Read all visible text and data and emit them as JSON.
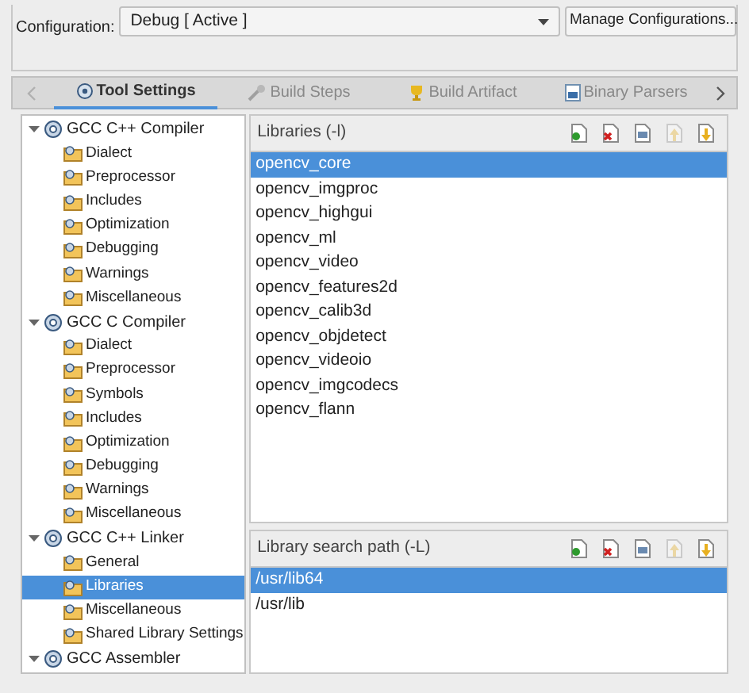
{
  "configuration": {
    "label": "Configuration:",
    "value": "Debug  [ Active ]",
    "manage_button": "Manage Configurations..."
  },
  "tabs": [
    {
      "label": "Tool Settings",
      "selected": true,
      "kind": "tool"
    },
    {
      "label": "Build Steps",
      "selected": false,
      "kind": "wrench"
    },
    {
      "label": "Build Artifact",
      "selected": false,
      "kind": "trophy"
    },
    {
      "label": "Binary Parsers",
      "selected": false,
      "kind": "binary"
    }
  ],
  "tree": [
    {
      "label": "GCC C++ Compiler",
      "expanded": true,
      "children": [
        {
          "label": "Dialect",
          "selected": false
        },
        {
          "label": "Preprocessor",
          "selected": false
        },
        {
          "label": "Includes",
          "selected": false
        },
        {
          "label": "Optimization",
          "selected": false
        },
        {
          "label": "Debugging",
          "selected": false
        },
        {
          "label": "Warnings",
          "selected": false
        },
        {
          "label": "Miscellaneous",
          "selected": false
        }
      ]
    },
    {
      "label": "GCC C Compiler",
      "expanded": true,
      "children": [
        {
          "label": "Dialect",
          "selected": false
        },
        {
          "label": "Preprocessor",
          "selected": false
        },
        {
          "label": "Symbols",
          "selected": false
        },
        {
          "label": "Includes",
          "selected": false
        },
        {
          "label": "Optimization",
          "selected": false
        },
        {
          "label": "Debugging",
          "selected": false
        },
        {
          "label": "Warnings",
          "selected": false
        },
        {
          "label": "Miscellaneous",
          "selected": false
        }
      ]
    },
    {
      "label": "GCC C++ Linker",
      "expanded": true,
      "children": [
        {
          "label": "General",
          "selected": false
        },
        {
          "label": "Libraries",
          "selected": true
        },
        {
          "label": "Miscellaneous",
          "selected": false
        },
        {
          "label": "Shared Library Settings",
          "selected": false
        }
      ]
    },
    {
      "label": "GCC Assembler",
      "expanded": true
    }
  ],
  "lists": [
    {
      "title": "Libraries (-l)",
      "tools": [
        {
          "kind": "add",
          "disabled": false
        },
        {
          "kind": "delete",
          "disabled": false
        },
        {
          "kind": "edit",
          "disabled": false
        },
        {
          "kind": "up",
          "disabled": true
        },
        {
          "kind": "down",
          "disabled": false
        }
      ],
      "items": [
        {
          "label": "opencv_core",
          "selected": true
        },
        {
          "label": "opencv_imgproc",
          "selected": false
        },
        {
          "label": "opencv_highgui",
          "selected": false
        },
        {
          "label": "opencv_ml",
          "selected": false
        },
        {
          "label": "opencv_video",
          "selected": false
        },
        {
          "label": "opencv_features2d",
          "selected": false
        },
        {
          "label": "opencv_calib3d",
          "selected": false
        },
        {
          "label": "opencv_objdetect",
          "selected": false
        },
        {
          "label": "opencv_videoio",
          "selected": false
        },
        {
          "label": "opencv_imgcodecs",
          "selected": false
        },
        {
          "label": "opencv_flann",
          "selected": false
        }
      ]
    },
    {
      "title": "Library search path (-L)",
      "tools": [
        {
          "kind": "add",
          "disabled": false
        },
        {
          "kind": "delete",
          "disabled": false
        },
        {
          "kind": "edit",
          "disabled": false
        },
        {
          "kind": "up",
          "disabled": true
        },
        {
          "kind": "down",
          "disabled": false
        }
      ],
      "items": [
        {
          "label": "/usr/lib64",
          "selected": true
        },
        {
          "label": "/usr/lib",
          "selected": false
        }
      ]
    }
  ]
}
